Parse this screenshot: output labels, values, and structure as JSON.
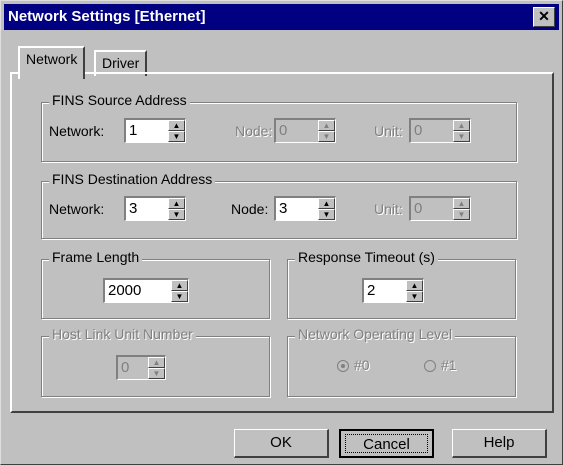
{
  "window": {
    "title": "Network Settings [Ethernet]",
    "close_glyph": "✕"
  },
  "tabs": [
    {
      "label": "Network",
      "active": true
    },
    {
      "label": "Driver",
      "active": false
    }
  ],
  "fins_source": {
    "legend": "FINS Source Address",
    "network_label": "Network:",
    "network_value": "1",
    "node_label": "Node:",
    "node_value": "0",
    "unit_label": "Unit:",
    "unit_value": "0"
  },
  "fins_destination": {
    "legend": "FINS Destination Address",
    "network_label": "Network:",
    "network_value": "3",
    "node_label": "Node:",
    "node_value": "3",
    "unit_label": "Unit:",
    "unit_value": "0"
  },
  "frame_length": {
    "legend": "Frame Length",
    "value": "2000"
  },
  "response_timeout": {
    "legend": "Response Timeout (s)",
    "value": "2"
  },
  "host_link": {
    "legend": "Host Link Unit Number",
    "value": "0"
  },
  "network_level": {
    "legend": "Network Operating Level",
    "options": [
      "#0",
      "#1"
    ],
    "selected": "#0"
  },
  "buttons": {
    "ok": "OK",
    "cancel": "Cancel",
    "help": "Help"
  },
  "icons": {
    "spin_up": "▲",
    "spin_down": "▼"
  }
}
